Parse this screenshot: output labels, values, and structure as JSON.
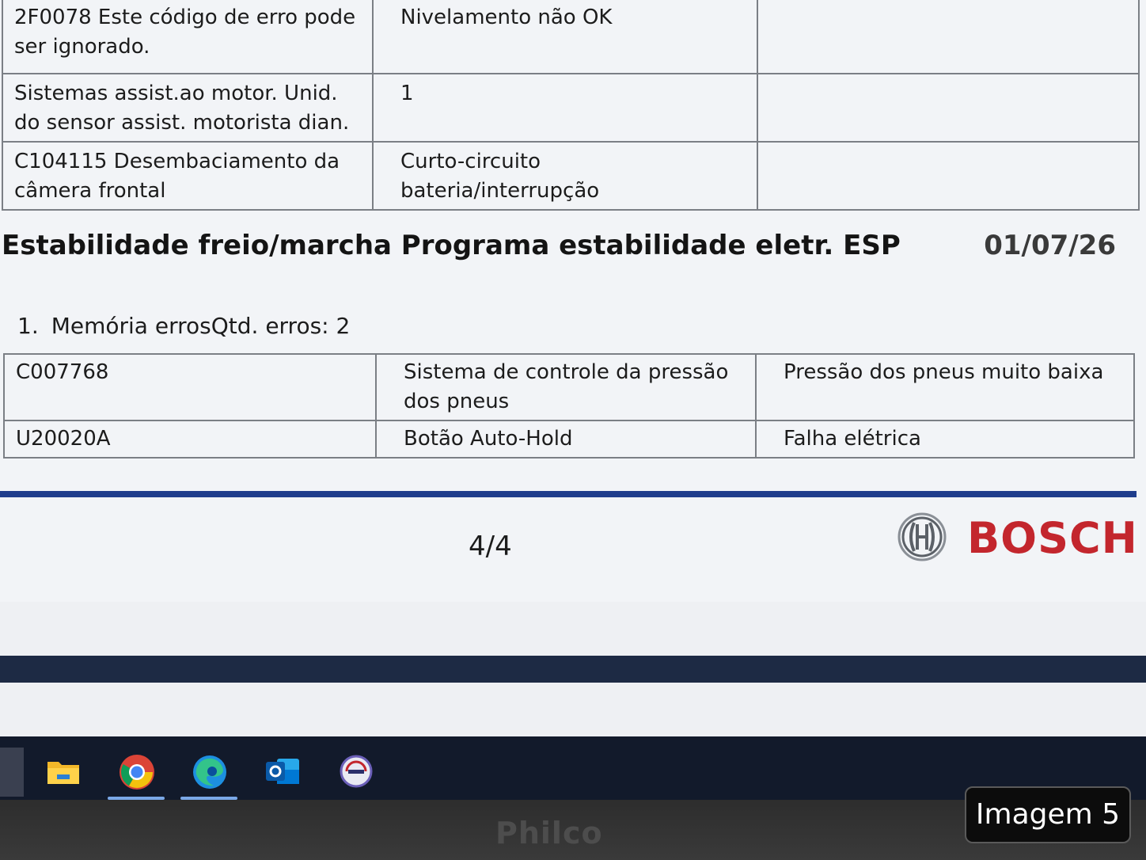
{
  "top_table": {
    "rows": [
      [
        "2F0078 Este código de erro pode ser ignorado.",
        "Nivelamento não OK",
        ""
      ],
      [
        "Sistemas assist.ao motor. Unid. do sensor assist. motorista dian.",
        "1",
        ""
      ],
      [
        "C104115 Desembaciamento da câmera frontal",
        "Curto-circuito bateria/interrupção",
        ""
      ]
    ]
  },
  "section": {
    "title": "Estabilidade freio/marcha Programa estabilidade eletr. ESP",
    "date": "01/07/26",
    "memory_number": "1.",
    "memory_text": "Memória errosQtd. erros: 2"
  },
  "error_table": {
    "rows": [
      [
        "C007768",
        "Sistema de controle da pressão dos pneus",
        "Pressão dos pneus muito baixa"
      ],
      [
        "U20020A",
        "Botão Auto-Hold",
        "Falha elétrica"
      ]
    ]
  },
  "footer": {
    "page": "4/4",
    "brand": "BOSCH",
    "rule_color": "#1f3d8c",
    "brand_color": "#c3262d"
  },
  "taskbar": {
    "apps": [
      {
        "icon": "file-explorer-icon",
        "active": false
      },
      {
        "icon": "chrome-icon",
        "active": true
      },
      {
        "icon": "edge-icon",
        "active": true
      },
      {
        "icon": "outlook-icon",
        "active": false
      },
      {
        "icon": "diagnostic-app-icon",
        "active": false
      }
    ]
  },
  "monitor": {
    "brand": "Philco"
  },
  "caption": "Imagem 5"
}
